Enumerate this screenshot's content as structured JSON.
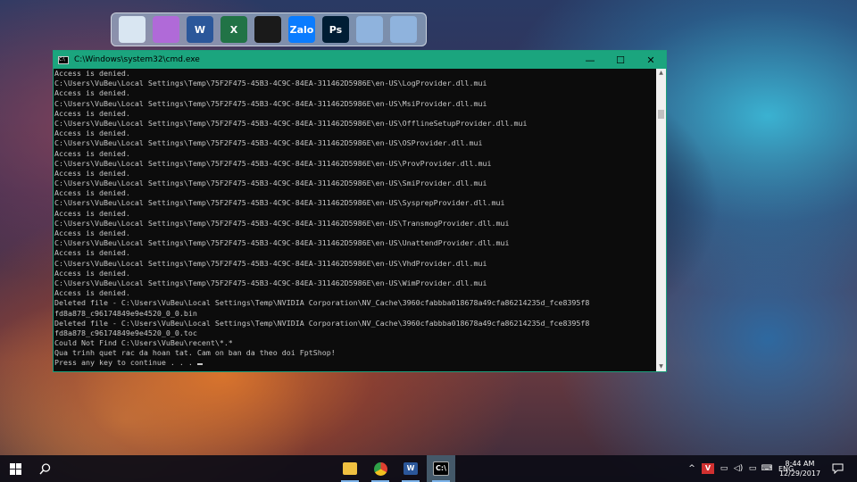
{
  "dock": {
    "items": [
      {
        "name": "computer-icon",
        "color": "#d9e6f2"
      },
      {
        "name": "recycle-bin-icon",
        "color": "#b06ad8"
      },
      {
        "name": "word-icon",
        "label": "W",
        "color": "#2b579a"
      },
      {
        "name": "excel-icon",
        "label": "X",
        "color": "#217346"
      },
      {
        "name": "garena-icon",
        "color": "#1a1a1a"
      },
      {
        "name": "zalo-icon",
        "label": "Zalo",
        "color": "#0a7cff"
      },
      {
        "name": "photoshop-icon",
        "label": "Ps",
        "color": "#001d34"
      },
      {
        "name": "folder-blue-icon",
        "color": "#8fb3dd"
      },
      {
        "name": "folder-blue-icon-2",
        "color": "#8fb3dd"
      }
    ]
  },
  "window": {
    "title": "C:\\Windows\\system32\\cmd.exe",
    "minimize": "—",
    "maximize": "☐",
    "close": "✕"
  },
  "console": {
    "lines": [
      "Access is denied.",
      "C:\\Users\\VuBeu\\Local Settings\\Temp\\75F2F475-45B3-4C9C-84EA-311462D5986E\\en-US\\LogProvider.dll.mui",
      "Access is denied.",
      "C:\\Users\\VuBeu\\Local Settings\\Temp\\75F2F475-45B3-4C9C-84EA-311462D5986E\\en-US\\MsiProvider.dll.mui",
      "Access is denied.",
      "C:\\Users\\VuBeu\\Local Settings\\Temp\\75F2F475-45B3-4C9C-84EA-311462D5986E\\en-US\\OfflineSetupProvider.dll.mui",
      "Access is denied.",
      "C:\\Users\\VuBeu\\Local Settings\\Temp\\75F2F475-45B3-4C9C-84EA-311462D5986E\\en-US\\OSProvider.dll.mui",
      "Access is denied.",
      "C:\\Users\\VuBeu\\Local Settings\\Temp\\75F2F475-45B3-4C9C-84EA-311462D5986E\\en-US\\ProvProvider.dll.mui",
      "Access is denied.",
      "C:\\Users\\VuBeu\\Local Settings\\Temp\\75F2F475-45B3-4C9C-84EA-311462D5986E\\en-US\\SmiProvider.dll.mui",
      "Access is denied.",
      "C:\\Users\\VuBeu\\Local Settings\\Temp\\75F2F475-45B3-4C9C-84EA-311462D5986E\\en-US\\SysprepProvider.dll.mui",
      "Access is denied.",
      "C:\\Users\\VuBeu\\Local Settings\\Temp\\75F2F475-45B3-4C9C-84EA-311462D5986E\\en-US\\TransmogProvider.dll.mui",
      "Access is denied.",
      "C:\\Users\\VuBeu\\Local Settings\\Temp\\75F2F475-45B3-4C9C-84EA-311462D5986E\\en-US\\UnattendProvider.dll.mui",
      "Access is denied.",
      "C:\\Users\\VuBeu\\Local Settings\\Temp\\75F2F475-45B3-4C9C-84EA-311462D5986E\\en-US\\VhdProvider.dll.mui",
      "Access is denied.",
      "C:\\Users\\VuBeu\\Local Settings\\Temp\\75F2F475-45B3-4C9C-84EA-311462D5986E\\en-US\\WimProvider.dll.mui",
      "Access is denied.",
      "Deleted file - C:\\Users\\VuBeu\\Local Settings\\Temp\\NVIDIA Corporation\\NV_Cache\\3960cfabbba018678a49cfa86214235d_fce8395f8",
      "fd8a878_c96174849e9e4520_0_0.bin",
      "Deleted file - C:\\Users\\VuBeu\\Local Settings\\Temp\\NVIDIA Corporation\\NV_Cache\\3960cfabbba018678a49cfa86214235d_fce8395f8",
      "fd8a878_c96174849e9e4520_0_0.toc",
      "Could Not Find C:\\Users\\VuBeu\\recent\\*.*",
      "Qua trinh quet rac da hoan tat. Cam on ban da theo doi FptShop!",
      "Press any key to continue . . . "
    ]
  },
  "taskbar": {
    "start_icon": "windows-start-icon",
    "search_icon": "search-icon",
    "apps": [
      {
        "name": "file-explorer-icon",
        "color": "#f0c040"
      },
      {
        "name": "chrome-icon",
        "color": "#e04030"
      },
      {
        "name": "word-icon",
        "label": "W",
        "color": "#2b579a"
      },
      {
        "name": "cmd-icon",
        "label": "C:\\",
        "color": "#000000",
        "active": true
      }
    ],
    "tray": {
      "chevron": "^",
      "language": "ENG",
      "time": "8:44 AM",
      "date": "12/29/2017"
    }
  }
}
